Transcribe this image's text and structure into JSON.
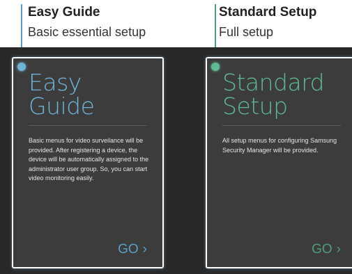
{
  "easy": {
    "callout_title": "Easy Guide",
    "callout_subtitle": "Basic essential setup",
    "heading_line1": "Easy",
    "heading_line2": "Guide",
    "description": "Basic menus for video surveilance will be provided. After registering a device, the device will be automatically assigned to the administrator user group. So, you can start video monitoring easily.",
    "go_label": "GO",
    "accent_color": "#6fb3d6"
  },
  "standard": {
    "callout_title": "Standard Setup",
    "callout_subtitle": "Full setup",
    "heading_line1": "Standard",
    "heading_line2": "Setup",
    "description": "All setup menus for configuring Samsung Security Manager will be provided.",
    "go_label": "GO",
    "accent_color": "#5fba93"
  },
  "icons": {
    "go_chevron": "chevron-right-icon",
    "callout_dot": "callout-dot-icon"
  }
}
